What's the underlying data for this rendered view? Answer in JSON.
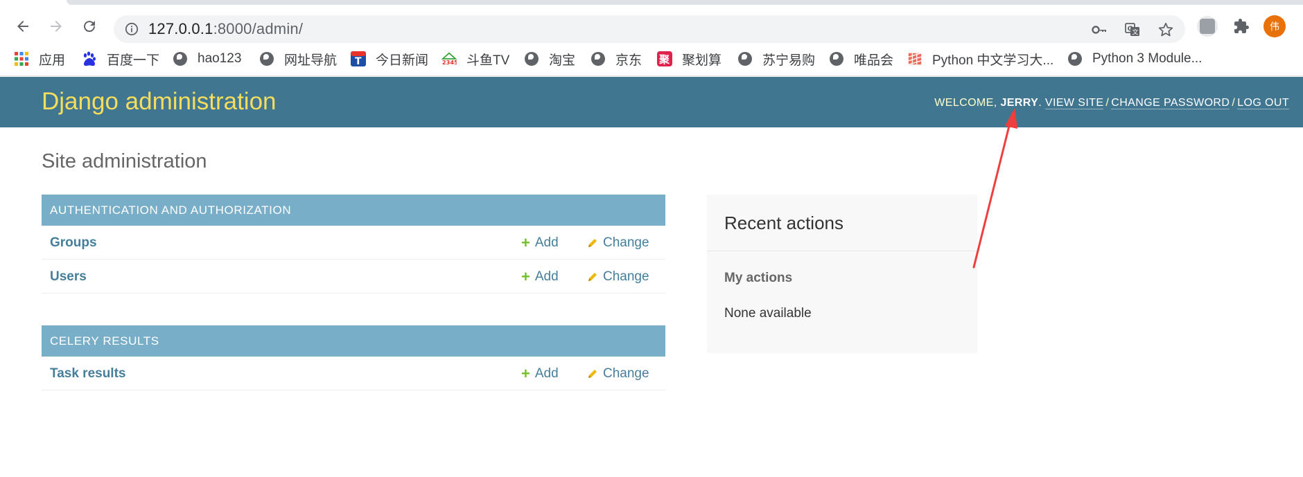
{
  "browser": {
    "url_host": "127.0.0.1",
    "url_rest": ":8000/admin/",
    "profile_initial": "伟",
    "icons": {
      "back": "back-arrow-icon",
      "forward": "forward-arrow-icon",
      "reload": "reload-icon",
      "site_info": "info-icon",
      "password": "key-icon",
      "translate": "translate-icon",
      "bookmark_star": "star-icon",
      "extension": "extension-icon",
      "extensions_menu": "puzzle-icon"
    },
    "bookmarks": [
      {
        "label": "应用",
        "icon": "apps-grid-icon"
      },
      {
        "label": "百度一下",
        "icon": "baidu-icon"
      },
      {
        "label": "hao123",
        "icon": "globe-icon"
      },
      {
        "label": "网址导航",
        "icon": "globe-icon"
      },
      {
        "label": "今日新闻",
        "icon": "news-icon"
      },
      {
        "label": "斗鱼TV",
        "icon": "douyu-icon"
      },
      {
        "label": "淘宝",
        "icon": "globe-icon"
      },
      {
        "label": "京东",
        "icon": "globe-icon"
      },
      {
        "label": "聚划算",
        "icon": "juhuasuan-icon"
      },
      {
        "label": "苏宁易购",
        "icon": "globe-icon"
      },
      {
        "label": "唯品会",
        "icon": "globe-icon"
      },
      {
        "label": "Python 中文学习大...",
        "icon": "python-doc-icon"
      },
      {
        "label": "Python 3 Module...",
        "icon": "globe-icon"
      }
    ]
  },
  "header": {
    "branding": "Django administration",
    "welcome": "WELCOME, ",
    "username": "JERRY",
    "period": ". ",
    "view_site": "VIEW SITE",
    "change_password": "CHANGE PASSWORD",
    "log_out": "LOG OUT",
    "separator": "/"
  },
  "content": {
    "title": "Site administration",
    "modules": [
      {
        "caption": "AUTHENTICATION AND AUTHORIZATION",
        "models": [
          {
            "name": "Groups",
            "add": "Add",
            "change": "Change"
          },
          {
            "name": "Users",
            "add": "Add",
            "change": "Change"
          }
        ]
      },
      {
        "caption": "CELERY RESULTS",
        "models": [
          {
            "name": "Task results",
            "add": "Add",
            "change": "Change"
          }
        ]
      }
    ]
  },
  "sidebar": {
    "title": "Recent actions",
    "my_actions": "My actions",
    "none": "None available"
  },
  "annotation": {
    "color": "#ef3e3e",
    "icon": "red-arrow-annotation"
  },
  "colors": {
    "header_bg": "#417690",
    "branding": "#f5dd5d",
    "caption_bg": "#79aec8",
    "link": "#447e9b",
    "add_green": "#70bf2b",
    "change_yellow": "#efb80b"
  }
}
